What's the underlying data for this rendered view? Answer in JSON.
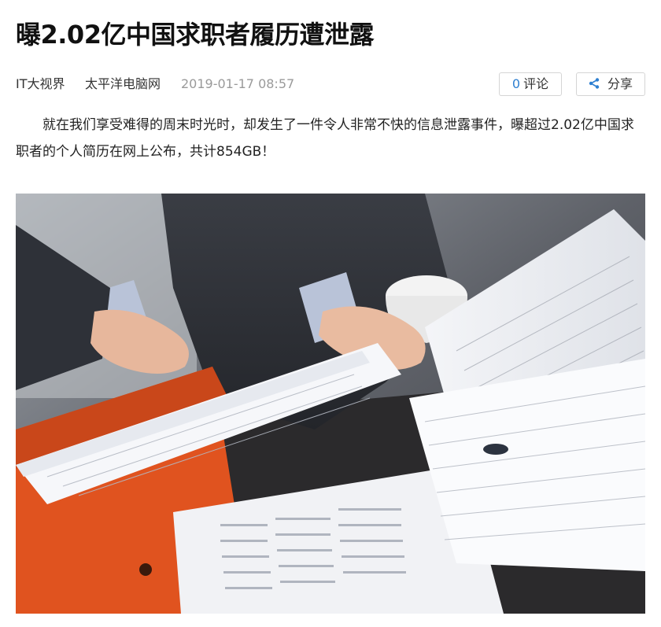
{
  "article": {
    "title": "曝2.02亿中国求职者履历遭泄露",
    "channel": "IT大视界",
    "source": "太平洋电脑网",
    "date": "2019-01-17 08:57",
    "body": "就在我们享受难得的周末时光时，却发生了一件令人非常不快的信息泄露事件，曝超过2.02亿中国求职者的个人简历在网上公布，共计854GB！"
  },
  "actions": {
    "comment_count": "0",
    "comment_label": "评论",
    "share_label": "分享",
    "share_icon": "share-icon"
  },
  "image": {
    "subject": "hands-holding-documents-photo"
  },
  "colors": {
    "accent": "#2f80d1",
    "date_gray": "#9a9a9a",
    "folder_orange": "#e0531f"
  }
}
